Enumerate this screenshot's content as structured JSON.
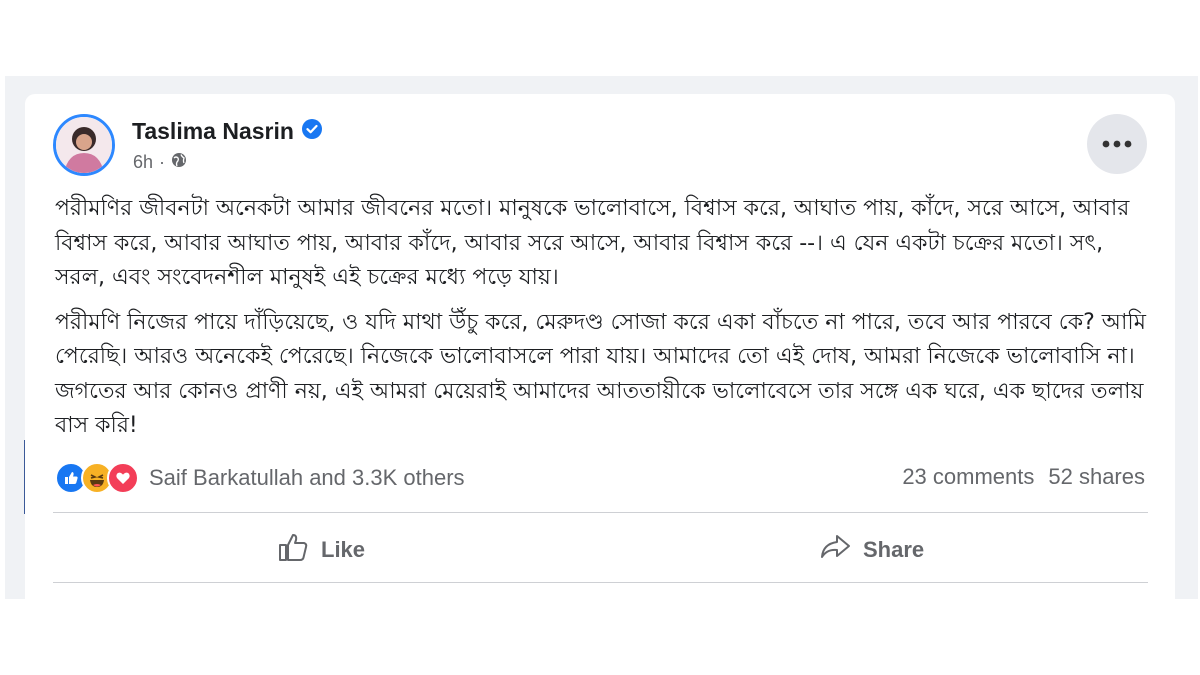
{
  "post": {
    "author": "Taslima Nasrin",
    "time": "6h",
    "separator": "·",
    "paragraphs": [
      "পরীমণির জীবনটা অনেকটা আমার জীবনের মতো। মানুষকে ভালোবাসে, বিশ্বাস করে, আঘাত পায়, কাঁদে, সরে আসে, আবার বিশ্বাস করে, আবার আঘাত পায়, আবার কাঁদে, আবার সরে আসে, আবার বিশ্বাস করে --। এ যেন একটা চক্রের মতো। সৎ, সরল,  এবং সংবেদনশীল মানুষই  এই চক্রের মধ্যে পড়ে যায়।",
      "পরীমণি নিজের পায়ে দাঁড়িয়েছে, ও যদি মাথা উঁচু করে, মেরুদণ্ড সোজা করে একা বাঁচতে না পারে, তবে আর পারবে কে? আমি পেরেছি। আরও অনেকেই পেরেছে। নিজেকে ভালোবাসলে পারা যায়। আমাদের তো এই দোষ, আমরা নিজেকে ভালোবাসি না। জগতের আর কোনও প্রাণী নয়, এই আমরা মেয়েরাই আমাদের আততায়ীকে ভালোবেসে তার সঙ্গে এক ঘরে, এক ছাদের তলায়  বাস করি!"
    ],
    "reactions_text": "Saif Barkatullah and 3.3K others",
    "comments": "23 comments",
    "shares": "52 shares"
  },
  "actions": {
    "like_label": "Like",
    "share_label": "Share"
  },
  "icons": {
    "verified": "verified-badge-icon",
    "privacy": "globe-icon",
    "more": "more-dots-icon",
    "like": "thumbs-up-icon",
    "share": "share-arrow-icon"
  },
  "colors": {
    "verified": "#1877f2",
    "like_reaction": "#1877f2",
    "haha_reaction": "#f7b125",
    "love_reaction": "#f33e58",
    "secondary_text": "#65676b"
  }
}
